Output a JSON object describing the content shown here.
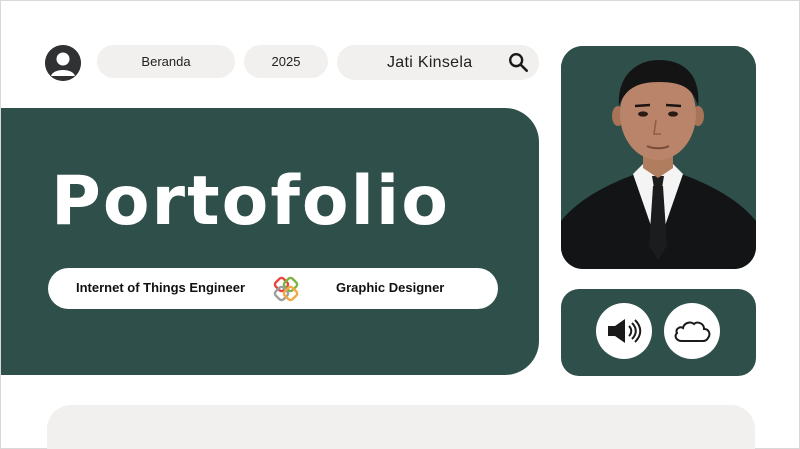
{
  "nav": {
    "home_label": "Beranda",
    "year_label": "2025",
    "search_value": "Jati Kinsela"
  },
  "icons": {
    "user": "user-icon",
    "search": "search-icon",
    "logo": "interlocked-hearts-logo",
    "sound": "speaker-icon",
    "cloud": "cloud-icon"
  },
  "hero": {
    "title": "Portofolio",
    "roles": [
      "Internet of Things Engineer",
      "Graphic Designer"
    ]
  },
  "colors": {
    "primary": "#2f4f4a",
    "pill": "#f1f0ee",
    "background": "#ffffff"
  }
}
